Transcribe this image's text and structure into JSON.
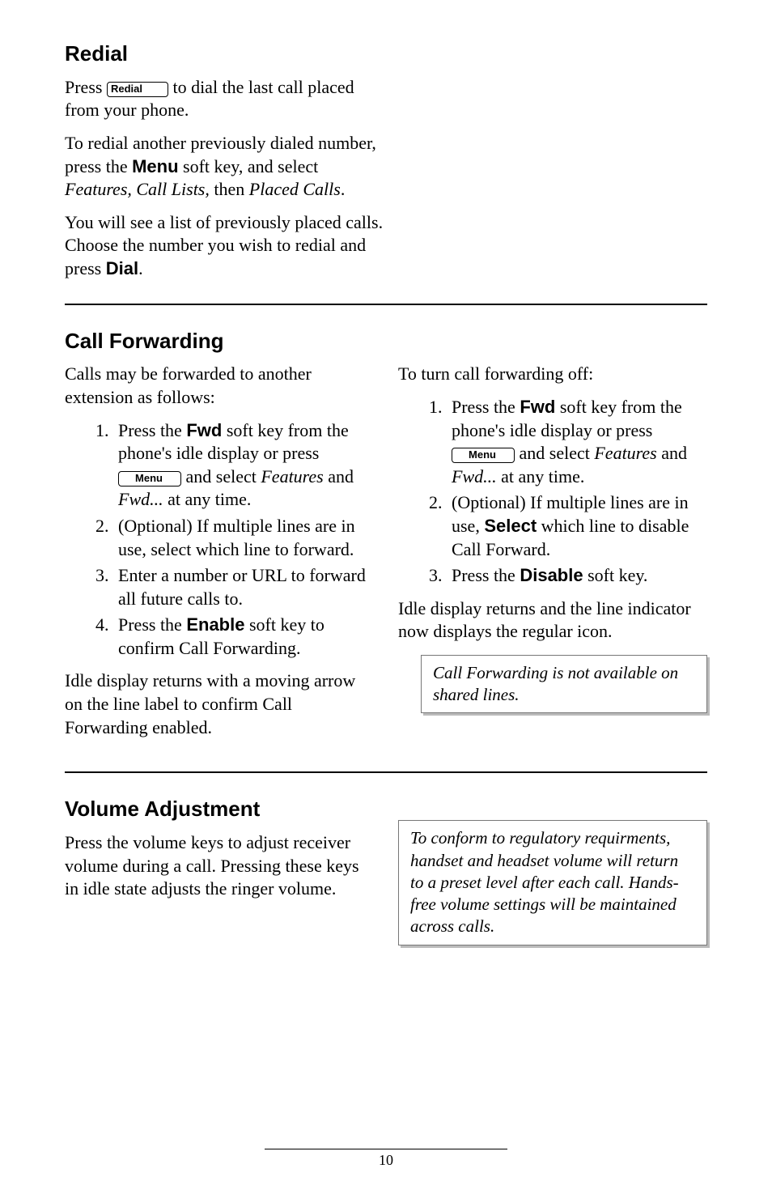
{
  "buttons": {
    "redial": "Redial",
    "menu": "Menu"
  },
  "softkeys": {
    "menu": "Menu",
    "dial": "Dial",
    "fwd": "Fwd",
    "enable": "Enable",
    "select": "Select",
    "disable": "Disable"
  },
  "redial": {
    "heading": "Redial",
    "p1_a": "Press ",
    "p1_b": " to dial the last call placed from your phone.",
    "p2_a": "To redial another previously dialed number, press the ",
    "p2_b": " soft key, and select ",
    "p2_c": "Features, Call Lists,",
    "p2_d": " then ",
    "p2_e": "Placed Calls",
    "p2_f": ".",
    "p3_a": "You will see a list of previously placed calls. Choose the number you wish to redial and press ",
    "p3_b": "."
  },
  "callfwd": {
    "heading": "Call Forwarding",
    "intro": "Calls may be forwarded to another extension as follows:",
    "on": {
      "s1_a": "Press the ",
      "s1_b": " soft key from the phone's idle display or press ",
      "s1_c": " and select ",
      "s1_d": "Features",
      "s1_e": " and ",
      "s1_f": "Fwd...",
      "s1_g": " at any time.",
      "s2": "(Optional) If multiple lines are in use, select which line to forward.",
      "s3": "Enter a number or URL to forward all future calls to.",
      "s4_a": "Press the ",
      "s4_b": " soft key to confirm Call Forwarding."
    },
    "idle_on": "Idle display returns with a moving arrow on the line label to confirm Call Forwarding enabled.",
    "off_intro": "To turn call forwarding off:",
    "off": {
      "s1_a": "Press the ",
      "s1_b": " soft key from the phone's idle display or press ",
      "s1_c": " and select ",
      "s1_d": "Features",
      "s1_e": " and ",
      "s1_f": "Fwd...",
      "s1_g": " at any time.",
      "s2_a": "(Optional) If multiple lines are in use, ",
      "s2_b": " which line to disable Call Forward.",
      "s3_a": "Press the ",
      "s3_b": " soft key."
    },
    "idle_off": "Idle display returns and the line indicator now displays the regular icon.",
    "note": "Call Forwarding is not available on shared lines."
  },
  "volume": {
    "heading": "Volume Adjustment",
    "p1": "Press the volume keys to adjust receiver volume during a call.  Pressing these keys in idle state adjusts the ringer volume.",
    "note": "To conform to regulatory requirments, handset and headset volume will return to a preset level after each call.  Hands-free volume settings will be maintained across calls."
  },
  "footer": {
    "page": "10"
  }
}
